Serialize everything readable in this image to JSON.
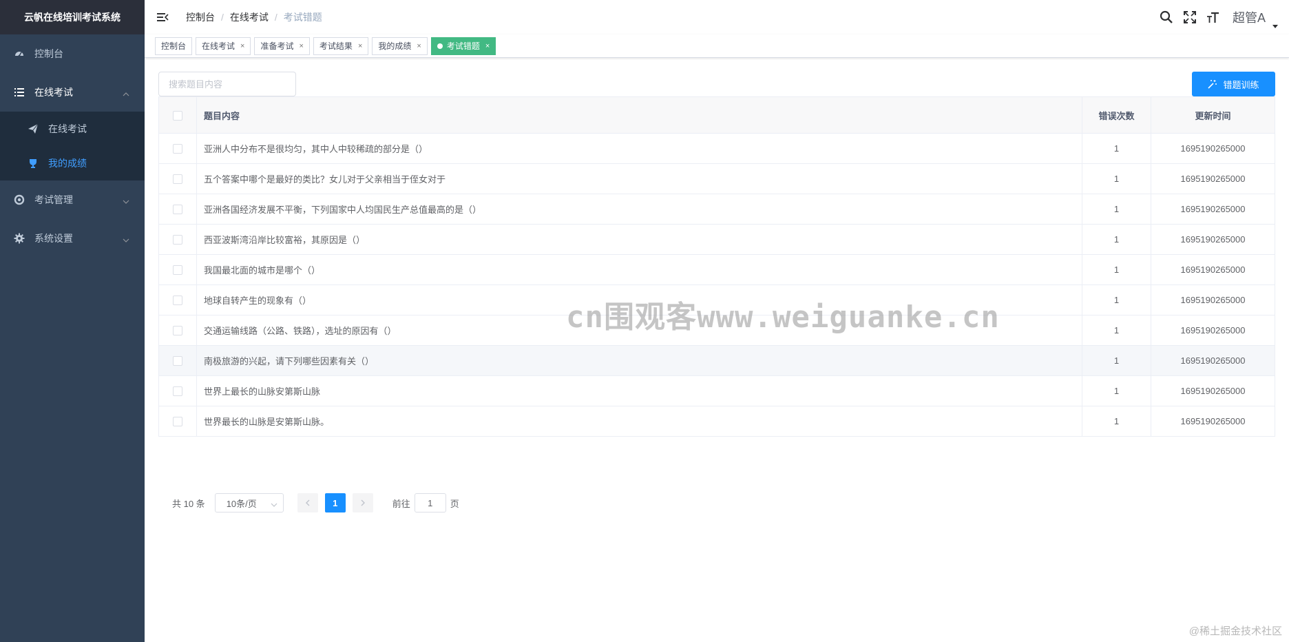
{
  "brand": "云帆在线培训考试系统",
  "sidebar": {
    "items": [
      {
        "label": "控制台",
        "icon": "dashboard-icon"
      },
      {
        "label": "在线考试",
        "icon": "list-icon"
      },
      {
        "label": "考试管理",
        "icon": "cycle-icon"
      },
      {
        "label": "系统设置",
        "icon": "gear-icon"
      }
    ],
    "sub_items": [
      {
        "label": "在线考试",
        "icon": "send-icon"
      },
      {
        "label": "我的成绩",
        "icon": "trophy-icon"
      }
    ]
  },
  "breadcrumb": [
    "控制台",
    "在线考试",
    "考试错题"
  ],
  "breadcrumb_sep": "/",
  "user": {
    "name": "超管A"
  },
  "tags": [
    {
      "label": "控制台"
    },
    {
      "label": "在线考试"
    },
    {
      "label": "准备考试"
    },
    {
      "label": "考试结果"
    },
    {
      "label": "我的成绩"
    },
    {
      "label": "考试错题"
    }
  ],
  "tag_close": "×",
  "search": {
    "placeholder": "搜索题目内容"
  },
  "train_button": "错题训练",
  "table": {
    "headers": {
      "content": "题目内容",
      "count": "错误次数",
      "time": "更新时间"
    },
    "rows": [
      {
        "content": "亚洲人中分布不是很均匀，其中人中较稀疏的部分是（）",
        "count": "1",
        "time": "1695190265000"
      },
      {
        "content": "五个答案中哪个是最好的类比？女儿对于父亲相当于侄女对于",
        "count": "1",
        "time": "1695190265000"
      },
      {
        "content": "亚洲各国经济发展不平衡，下列国家中人均国民生产总值最高的是（）",
        "count": "1",
        "time": "1695190265000"
      },
      {
        "content": "西亚波斯湾沿岸比较富裕，其原因是（）",
        "count": "1",
        "time": "1695190265000"
      },
      {
        "content": "我国最北面的城市是哪个（）",
        "count": "1",
        "time": "1695190265000"
      },
      {
        "content": "地球自转产生的现象有（）",
        "count": "1",
        "time": "1695190265000"
      },
      {
        "content": "交通运输线路（公路、铁路），选址的原因有（）",
        "count": "1",
        "time": "1695190265000"
      },
      {
        "content": "南极旅游的兴起，请下列哪些因素有关（）",
        "count": "1",
        "time": "1695190265000"
      },
      {
        "content": "世界上最长的山脉安第斯山脉",
        "count": "1",
        "time": "1695190265000"
      },
      {
        "content": "世界最长的山脉是安第斯山脉。",
        "count": "1",
        "time": "1695190265000"
      }
    ]
  },
  "pagination": {
    "total": "共 10 条",
    "page_size": "10条/页",
    "current": "1",
    "goto_prefix": "前往",
    "goto_value": "1",
    "goto_suffix": "页"
  },
  "watermark": "cn围观客www.weiguanke.cn",
  "credit": "@稀土掘金技术社区",
  "colors": {
    "sidebar_bg": "#304156",
    "submenu_bg": "#1f2d3d",
    "active_menu": "#409eff",
    "active_tag": "#42b983",
    "primary_button": "#1890ff"
  }
}
